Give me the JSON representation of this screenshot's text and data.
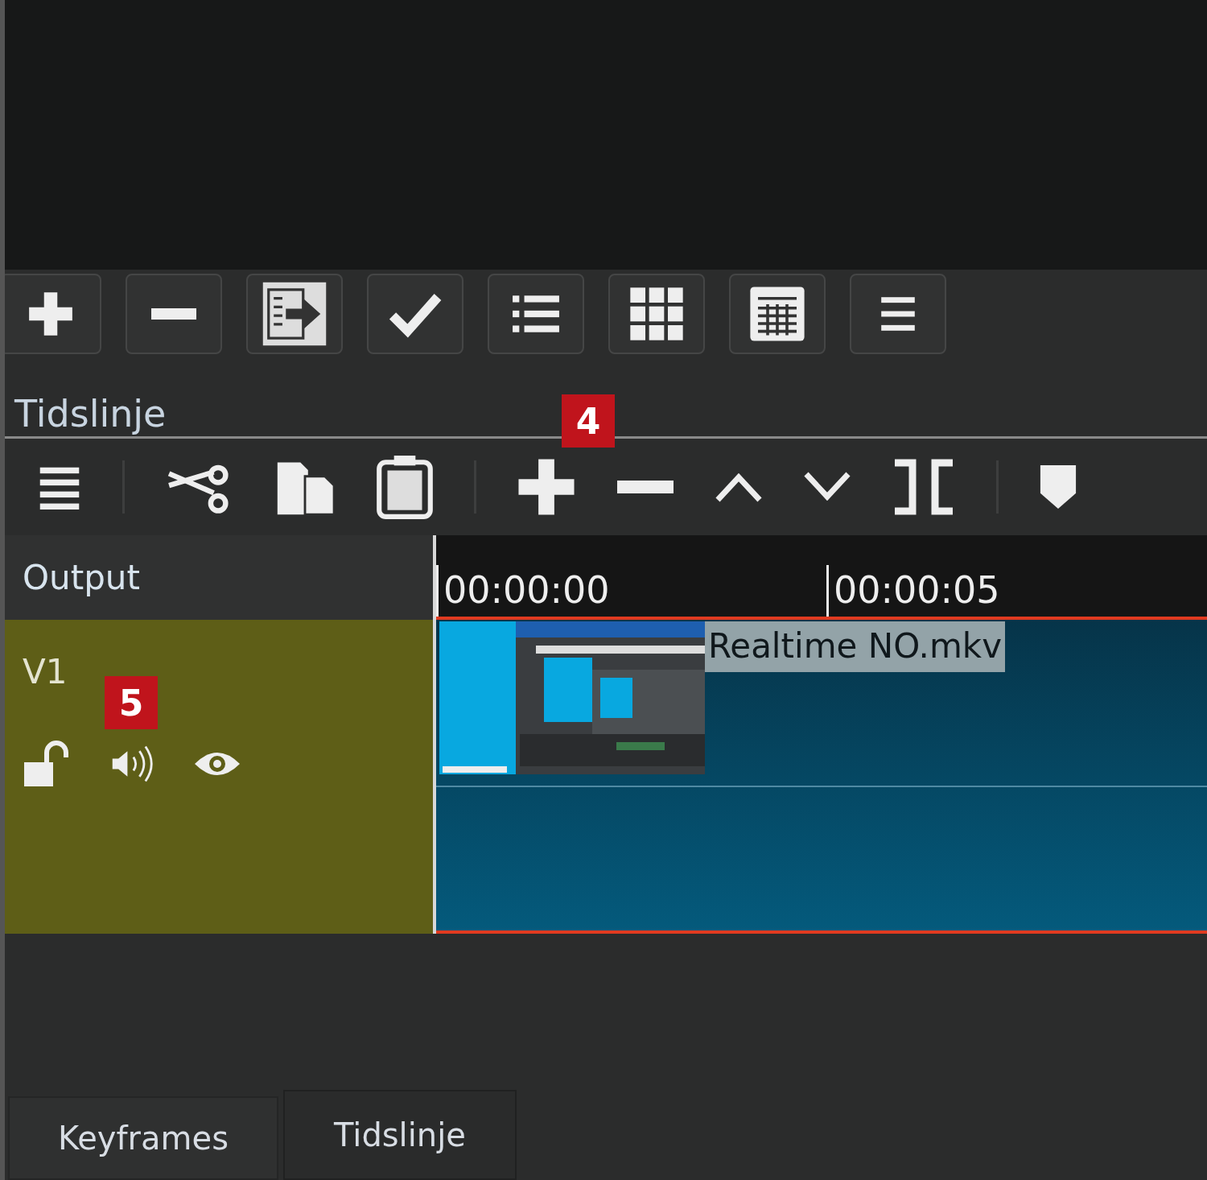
{
  "panel_title": "Tidslinje",
  "callouts": [
    {
      "label": "4"
    },
    {
      "label": "5"
    }
  ],
  "timeline": {
    "output_label": "Output",
    "ruler": [
      "00:00:00",
      "00:00:05"
    ],
    "track": {
      "name": "V1",
      "clip": {
        "name": "Realtime NO.mkv"
      }
    }
  },
  "tabs": [
    {
      "label": "Keyframes",
      "selected": false
    },
    {
      "label": "Tidslinje",
      "selected": true
    }
  ]
}
